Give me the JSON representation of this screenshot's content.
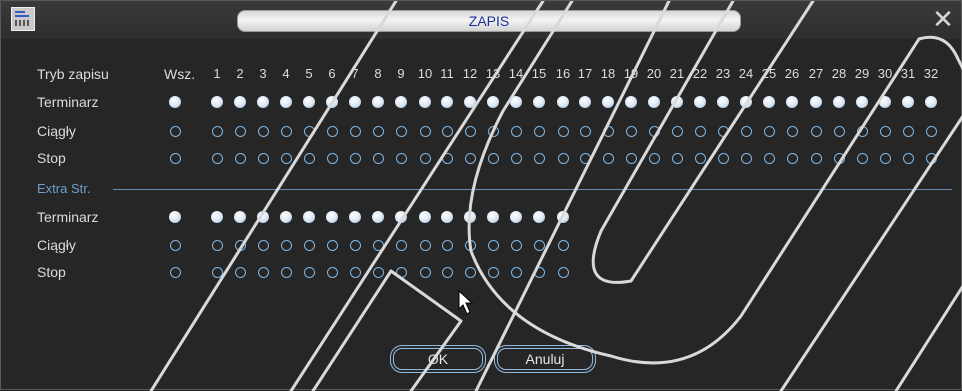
{
  "window": {
    "title": "ZAPIS",
    "close_glyph": "✕"
  },
  "header": {
    "mode_label": "Tryb zapisu",
    "all_label": "Wsz.",
    "channels": [
      "1",
      "2",
      "3",
      "4",
      "5",
      "6",
      "7",
      "8",
      "9",
      "10",
      "11",
      "12",
      "13",
      "14",
      "15",
      "16",
      "17",
      "18",
      "19",
      "20",
      "21",
      "22",
      "23",
      "24",
      "25",
      "26",
      "27",
      "28",
      "29",
      "30",
      "31",
      "32"
    ]
  },
  "main_rows": [
    {
      "label": "Terminarz",
      "selected": true
    },
    {
      "label": "Ciągły",
      "selected": false
    },
    {
      "label": "Stop",
      "selected": false
    }
  ],
  "extra": {
    "section_label": "Extra Str.",
    "channel_count": 16,
    "rows": [
      {
        "label": "Terminarz",
        "selected": true
      },
      {
        "label": "Ciągły",
        "selected": false
      },
      {
        "label": "Stop",
        "selected": false
      }
    ]
  },
  "buttons": {
    "ok": "OK",
    "cancel": "Anuluj"
  },
  "colors": {
    "accent": "#8fb9e1",
    "title_text": "#1a2f9a",
    "section_text": "#6f9fcc"
  },
  "icons": {
    "app": "record-schedule-icon",
    "close": "close-icon",
    "cursor": "mouse-pointer-icon"
  }
}
